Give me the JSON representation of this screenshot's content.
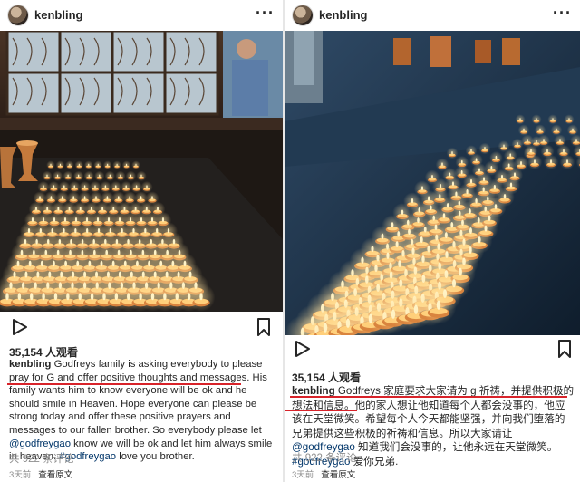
{
  "left_post": {
    "username": "kenbling",
    "more_label": "···",
    "views": "35,154 人观看",
    "caption_user": "kenbling",
    "caption_text": "Godfreys family is asking everybody to please pray for G and offer positive thoughts and messages. His family wants him to know everyone will be ok and he should smile in Heaven.  Hope everyone can please be strong today and offer these positive prayers and messages to our fallen brother.  So everybody please let ",
    "caption_mention": "@godfreygao",
    "caption_after_mention": " know we will be ok and let him always smile in heaven. ",
    "caption_hashtag": "#godfreygao",
    "caption_end": " love you brother.",
    "comments": "共 922 条评论",
    "time": "3天前",
    "see_original": "查看原文"
  },
  "right_post": {
    "username": "kenbling",
    "more_label": "···",
    "views": "35,154 人观看",
    "caption_user": "kenbling",
    "caption_text": " Godfreys 家庭要求大家请为 g 祈祷，并提供积极的想法和信息。他的家人想让他知道每个人都会没事的，他应该在天堂微笑。希望每个人今天都能坚强，并向我们堕落的兄弟提供这些积极的祈祷和信息。所以大家请让 ",
    "caption_mention": "@godfreygao",
    "caption_after_mention": " 知道我们会没事的，让他永远在天堂微笑。",
    "caption_hashtag": "#godfreygao",
    "caption_end": " 爱你兄弟.",
    "comments": "共 922 条评论",
    "time": "3天前",
    "see_original": "查看原文"
  },
  "icons": {
    "play": "play-icon",
    "bookmark": "bookmark-icon",
    "avatar": "avatar"
  },
  "colors": {
    "underline": "#d8232a",
    "candle_glow": "#ffb347",
    "link": "#003569"
  }
}
